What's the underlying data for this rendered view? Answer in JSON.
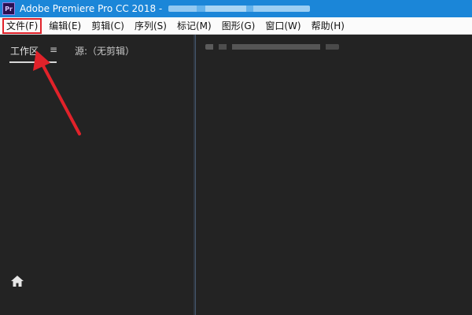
{
  "window": {
    "app_icon": "Pr",
    "title": "Adobe Premiere Pro CC 2018 -"
  },
  "menubar": {
    "items": [
      "文件(F)",
      "编辑(E)",
      "剪辑(C)",
      "序列(S)",
      "标记(M)",
      "图形(G)",
      "窗口(W)",
      "帮助(H)"
    ]
  },
  "left_panel": {
    "workspace_tab": "工作区",
    "source_tab": "源:（无剪辑）",
    "menu_glyph": "≡"
  },
  "colors": {
    "titlebar": "#1b86d8",
    "highlight": "#e1222a",
    "panel": "#232323"
  },
  "icons": {
    "home": "home-icon",
    "panel_menu": "hamburger-menu-icon",
    "annotation": "red-arrow-annotation"
  }
}
